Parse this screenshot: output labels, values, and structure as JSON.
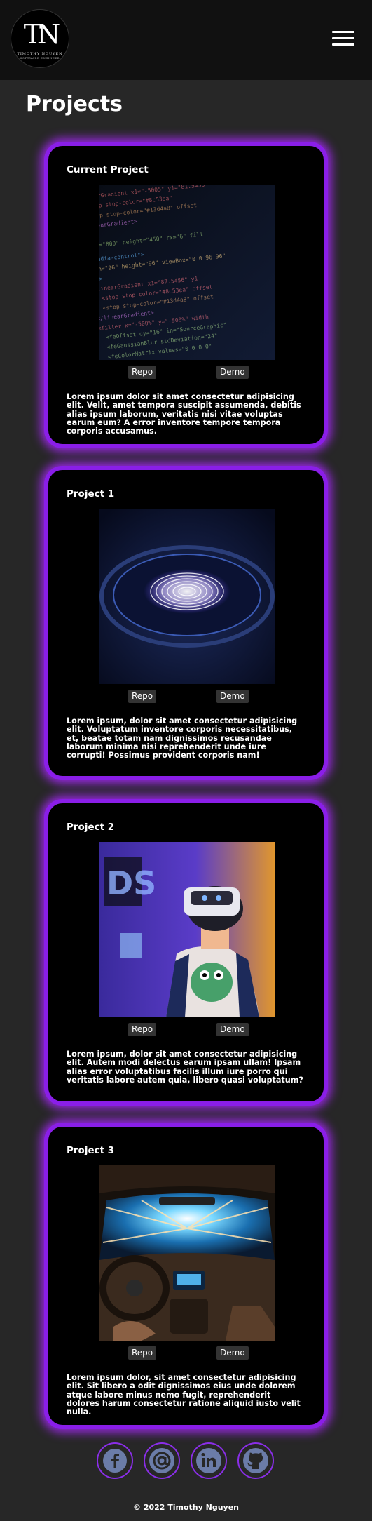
{
  "header": {
    "logo_mark": "TN",
    "logo_name": "TIMOTHY NGUYEN",
    "logo_sub": "SOFTWARE ENGINEER",
    "menu_icon": "hamburger-menu-icon"
  },
  "page": {
    "title": "Projects"
  },
  "projects": [
    {
      "title": "Current Project",
      "image": "code-screenshot",
      "repo_label": "Repo",
      "demo_label": "Demo",
      "description": "Lorem ipsum dolor sit amet consectetur adipisicing elit. Velit, amet tempora suscipit assumenda, debitis alias ipsum laborum, veritatis nisi vitae voluptas earum eum? A error inventore tempore tempora corporis accusamus."
    },
    {
      "title": "Project 1",
      "image": "fingerprint-scanner",
      "repo_label": "Repo",
      "demo_label": "Demo",
      "description": "Lorem ipsum, dolor sit amet consectetur adipisicing elit. Voluptatum inventore corporis necessitatibus, et, beatae totam nam dignissimos recusandae laborum minima nisi reprehenderit unde iure corrupti! Possimus provident corporis nam!"
    },
    {
      "title": "Project 2",
      "image": "vr-headset-person",
      "repo_label": "Repo",
      "demo_label": "Demo",
      "description": "Lorem ipsum, dolor sit amet consectetur adipisicing elit. Autem modi delectus earum ipsam ullam! Ipsam alias error voluptatibus facilis illum iure porro qui veritatis labore autem quia, libero quasi voluptatum?"
    },
    {
      "title": "Project 3",
      "image": "car-interior-light-trails",
      "repo_label": "Repo",
      "demo_label": "Demo",
      "description": "Lorem ipsum dolor, sit amet consectetur adipisicing elit. Sit libero a odit dignissimos eius unde dolorem atque labore minus nemo fugit, reprehenderit dolores harum consectetur ratione aliquid iusto velit nulla."
    }
  ],
  "socials": [
    {
      "icon": "facebook-icon"
    },
    {
      "icon": "email-at-icon"
    },
    {
      "icon": "linkedin-icon"
    },
    {
      "icon": "github-icon"
    }
  ],
  "footer": {
    "copyright": "© 2022 Timothy Nguyen"
  },
  "colors": {
    "background": "#272727",
    "header": "#111111",
    "card": "#000000",
    "accent": "#8a1ee8",
    "glow": "#aa28ff"
  }
}
